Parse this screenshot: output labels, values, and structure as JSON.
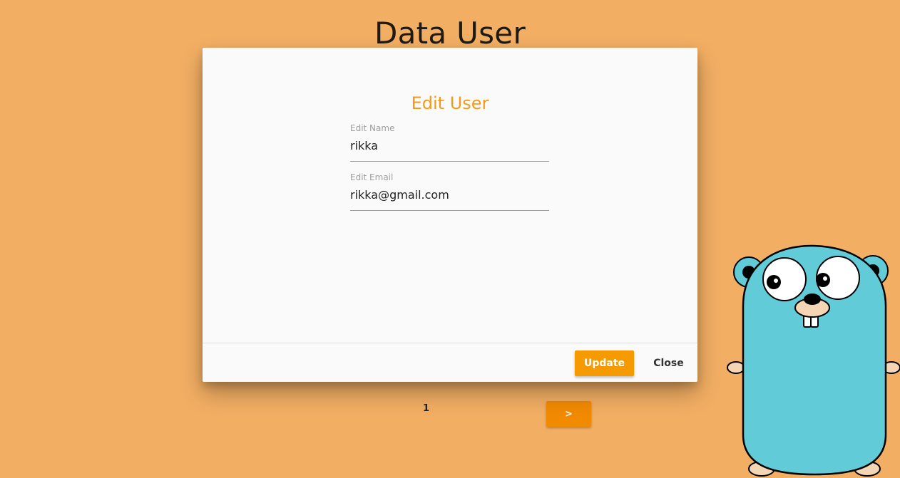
{
  "page": {
    "title": "Data User"
  },
  "pagination": {
    "current_page": "1",
    "next_label": ">"
  },
  "modal": {
    "title": "Edit User",
    "name_field": {
      "label": "Edit Name",
      "value": "rikka"
    },
    "email_field": {
      "label": "Edit Email",
      "value": "rikka@gmail.com"
    },
    "update_label": "Update",
    "close_label": "Close"
  },
  "mascot": {
    "icon": "gopher-icon"
  },
  "colors": {
    "background": "#f2ae63",
    "accent": "#f59a00",
    "gopher": "#62cbd8"
  }
}
